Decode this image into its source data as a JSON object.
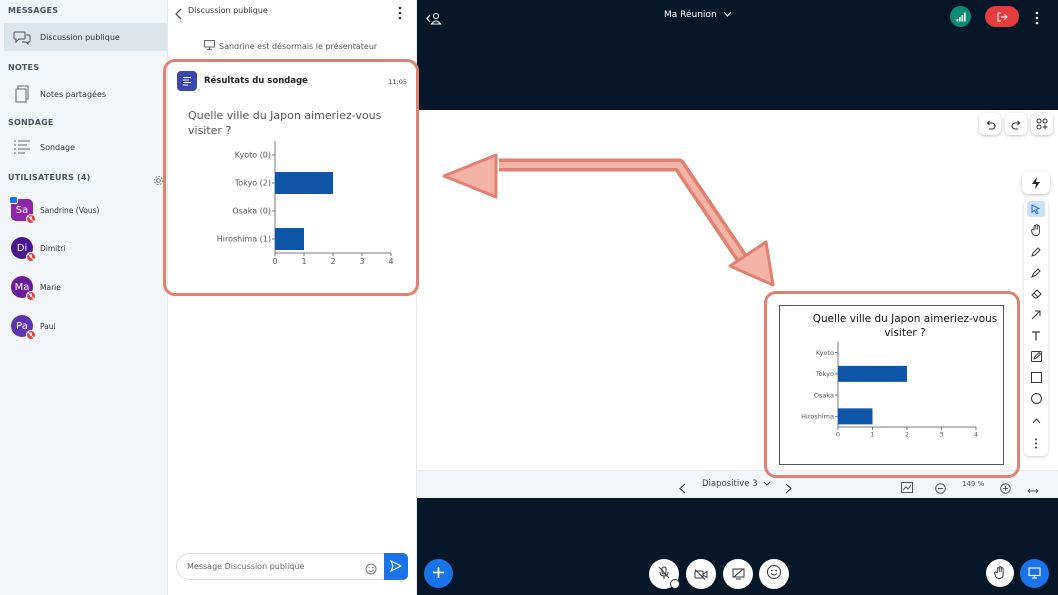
{
  "sidebar": {
    "messages_header": "MESSAGES",
    "public_chat": "Discussion publique",
    "notes_header": "NOTES",
    "shared_notes": "Notes partagées",
    "poll_header": "SONDAGE",
    "poll_item": "Sondage",
    "users_header": "UTILISATEURS (4)",
    "users": [
      {
        "initials": "Sa",
        "name": "Sandrine (Vous)",
        "color": "#8e24aa"
      },
      {
        "initials": "Di",
        "name": "Dimitri",
        "color": "#4a148c"
      },
      {
        "initials": "Ma",
        "name": "Marie",
        "color": "#6a1b9a"
      },
      {
        "initials": "Pa",
        "name": "Paul",
        "color": "#5e35b1"
      }
    ]
  },
  "chat": {
    "title": "Discussion publique",
    "system_message": "Sandrine est désormais le présentateur",
    "poll_card_title": "Résultats du sondage",
    "poll_time": "11:05",
    "question": "Quelle ville du Japon aimeriez-vous visiter ?",
    "input_placeholder": "Message Discussion publique"
  },
  "meeting": {
    "title": "Ma Réunion",
    "slide_label": "Diapositive 3",
    "zoom": "149 %"
  },
  "colors": {
    "accent": "#1a73e8",
    "bar": "#0f55a8",
    "highlight": "#e08070",
    "leave": "#e53c3c",
    "connection": "#0e8a75"
  },
  "chart_data": [
    {
      "type": "bar",
      "orientation": "horizontal",
      "categories": [
        "Kyoto (0)",
        "Tokyo (2)",
        "Osaka (0)",
        "Hiroshima (1)"
      ],
      "values": [
        0,
        2,
        0,
        1
      ],
      "xticks": [
        "0",
        "1",
        "2",
        "3",
        "4"
      ],
      "xlim": [
        0,
        4
      ]
    },
    {
      "type": "bar",
      "orientation": "horizontal",
      "title": "Quelle ville du Japon aimeriez-vous visiter ?",
      "categories": [
        "Kyoto",
        "Tokyo",
        "Osaka",
        "Hiroshima"
      ],
      "values": [
        0,
        2,
        0,
        1
      ],
      "xticks": [
        "0",
        "1",
        "2",
        "3",
        "4"
      ],
      "xlim": [
        0,
        4
      ]
    }
  ]
}
